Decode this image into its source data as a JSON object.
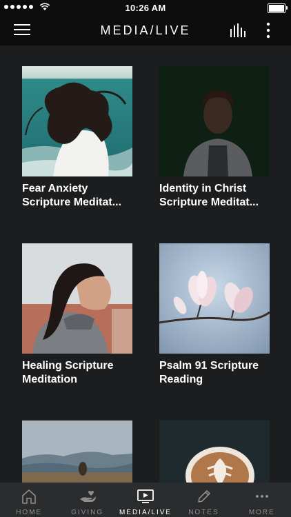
{
  "status_bar": {
    "time": "10:26 AM"
  },
  "header": {
    "title": "MEDIA/LIVE"
  },
  "media_items": [
    {
      "title": "Fear Anxiety Scripture Meditat..."
    },
    {
      "title": "Identity in Christ Scripture Meditat..."
    },
    {
      "title": "Healing Scripture Meditation"
    },
    {
      "title": "Psalm 91 Scripture Reading"
    },
    {
      "title": ""
    },
    {
      "title": ""
    }
  ],
  "tabs": [
    {
      "label": "HOME",
      "icon": "home-icon"
    },
    {
      "label": "GIVING",
      "icon": "giving-icon"
    },
    {
      "label": "MEDIA/LIVE",
      "icon": "media-play-icon",
      "active": true
    },
    {
      "label": "NOTES",
      "icon": "pencil-icon"
    },
    {
      "label": "MORE",
      "icon": "more-dots-icon"
    }
  ],
  "colors": {
    "background": "#1c1d1f",
    "bar": "#0d0d0d",
    "tabbar": "#2b2c2e",
    "inactive_tab": "#8e8e8e"
  }
}
